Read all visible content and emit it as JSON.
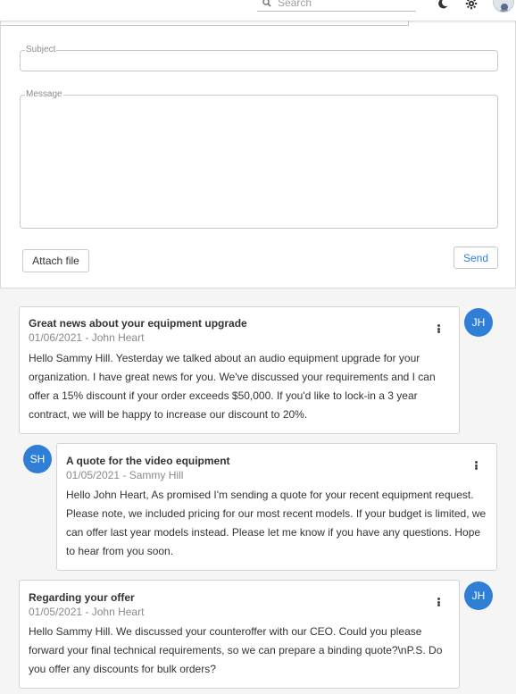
{
  "header": {
    "search_placeholder": "Search",
    "icons": [
      "search-icon",
      "dark-mode-moon-icon",
      "settings-gear-icon",
      "user-avatar"
    ]
  },
  "compose": {
    "subject_label": "Subject",
    "subject_value": "",
    "message_label": "Message",
    "message_value": "",
    "attach_label": "Attach file",
    "send_label": "Send"
  },
  "thread": [
    {
      "title": "Great news about your equipment upgrade",
      "meta": "01/06/2021 - John Heart",
      "initials": "JH",
      "body": "Hello Sammy Hill. Yesterday we talked about an audio equipment upgrade for your organization. I have great news for you. We've discussed your requirements and I can offer a 15% discount if your order exceeds $50,000. If you'd like to lock-in a 3 year contract, we will be happy to increase our discount to 20%."
    },
    {
      "title": "A quote for the video equipment",
      "meta": "01/05/2021 - Sammy Hill",
      "initials": "SH",
      "body": "Hello John Heart, As promised I'm sending a quote for your recent equipment request. Please note, we included pricing for our most recent models. If your budget is limited, we can offer last year models instead. Please let me know if you have any questions. Hope to hear from you soon."
    },
    {
      "title": "Regarding your offer",
      "meta": "01/05/2021 - John Heart",
      "initials": "JH",
      "body": "Hello Sammy Hill. We discussed your counteroffer with our CEO. Could you please forward your final technical requirements, so we can prepare a binding quote?\\nP.S. Do you offer any discounts for bulk orders?"
    }
  ],
  "colors": {
    "accent": "#2f7fd6",
    "badge_background": "#2f7fd6",
    "page_background": "#f5f5f5"
  }
}
